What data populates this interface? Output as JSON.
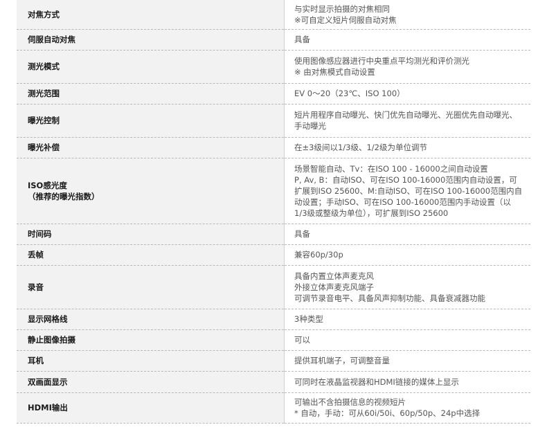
{
  "rows": [
    {
      "label": [
        "对焦方式"
      ],
      "value": [
        "与实时显示拍摄的对焦相同",
        "※可自定义短片伺服自动对焦"
      ]
    },
    {
      "label": [
        "伺服自动对焦"
      ],
      "value": [
        "具备"
      ]
    },
    {
      "label": [
        "测光模式"
      ],
      "value": [
        "使用图像感应器进行中央重点平均测光和评价测光",
        "※ 由对焦模式自动设置"
      ]
    },
    {
      "label": [
        "测光范围"
      ],
      "value": [
        "EV 0～20（23℃、ISO 100）"
      ]
    },
    {
      "label": [
        "曝光控制"
      ],
      "value": [
        "短片用程序自动曝光、快门优先自动曝光、光圈优先自动曝光、",
        "手动曝光"
      ]
    },
    {
      "label": [
        "曝光补偿"
      ],
      "value": [
        "在±3级间以1/3级、1/2级为单位调节"
      ]
    },
    {
      "label": [
        "ISO感光度",
        "（推荐的曝光指数）"
      ],
      "value": [
        "场景智能自动、Tv：在ISO 100 - 16000之间自动设置",
        "P, Av, B：自动ISO、可在ISO 100-16000范围内自动设置，可",
        "扩展到ISO 25600、M:自动ISO、可在ISO 100-16000范围内自",
        "动设置；手动ISO、可在ISO 100-16000范围内手动设置（以",
        "1/3级或整级为单位），可扩展到ISO 25600"
      ]
    },
    {
      "label": [
        "时间码"
      ],
      "value": [
        "具备"
      ]
    },
    {
      "label": [
        "丢帧"
      ],
      "value": [
        "兼容60p/30p"
      ]
    },
    {
      "label": [
        "录音"
      ],
      "value": [
        "具备内置立体声麦克风",
        "外接立体声麦克风端子",
        "可调节录音电平、具备风声抑制功能、具备衰减器功能"
      ]
    },
    {
      "label": [
        "显示网格线"
      ],
      "value": [
        "3种类型"
      ]
    },
    {
      "label": [
        "静止图像拍摄"
      ],
      "value": [
        "可以"
      ]
    },
    {
      "label": [
        "耳机"
      ],
      "value": [
        "提供耳机端子，可调整音量"
      ]
    },
    {
      "label": [
        "双画面显示"
      ],
      "value": [
        "可同时在液晶监视器和HDMI链接的媒体上显示"
      ]
    },
    {
      "label": [
        "HDMI输出"
      ],
      "value": [
        "可输出不含拍摄信息的视频短片",
        "* 自动，手动：可从60i/50i、60p/50p、24p中选择"
      ]
    }
  ]
}
